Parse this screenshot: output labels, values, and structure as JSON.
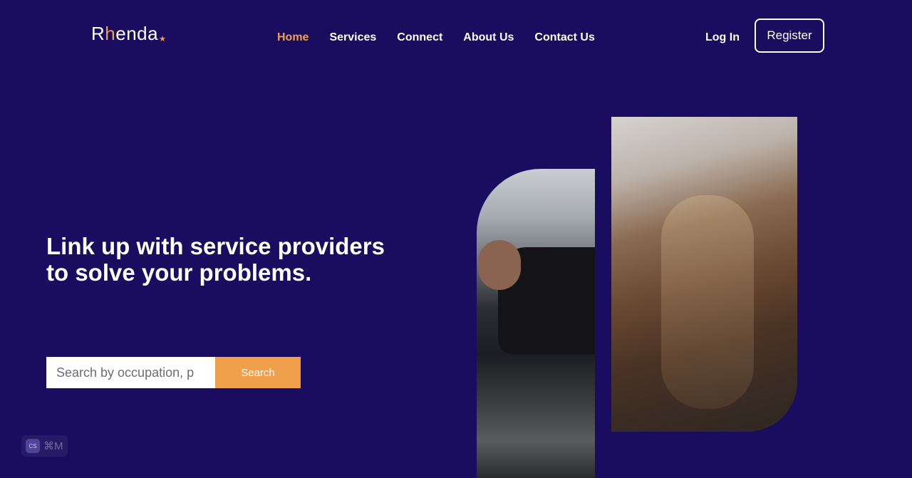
{
  "brand": {
    "name_start": "R",
    "name_accent": "h",
    "name_end": "enda",
    "star": "★"
  },
  "nav": {
    "items": [
      {
        "label": "Home",
        "active": true
      },
      {
        "label": "Services",
        "active": false
      },
      {
        "label": "Connect",
        "active": false
      },
      {
        "label": "About Us",
        "active": false
      },
      {
        "label": "Contact Us",
        "active": false
      }
    ]
  },
  "auth": {
    "login_label": "Log In",
    "register_label": "Register"
  },
  "hero": {
    "title_line1": "Link up with service providers",
    "title_line2": "to solve your problems."
  },
  "search": {
    "placeholder": "Search by occupation, p",
    "button_label": "Search"
  },
  "shortcut": {
    "badge": "CS",
    "keys": "⌘M"
  },
  "colors": {
    "background": "#1a0c5e",
    "accent": "#f0a04b",
    "text": "#ffffff"
  }
}
